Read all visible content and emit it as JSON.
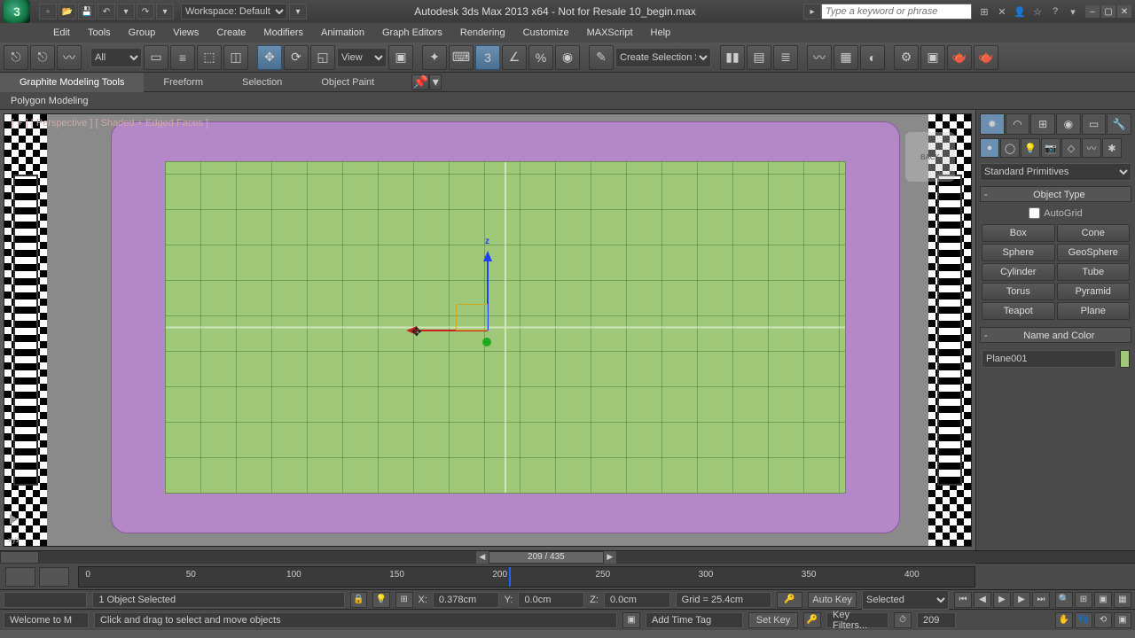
{
  "titlebar": {
    "workspace_label": "Workspace: Default",
    "title": "Autodesk 3ds Max  2013 x64 - Not for Resale    10_begin.max",
    "search_placeholder": "Type a keyword or phrase"
  },
  "menu": [
    "Edit",
    "Tools",
    "Group",
    "Views",
    "Create",
    "Modifiers",
    "Animation",
    "Graph Editors",
    "Rendering",
    "Customize",
    "MAXScript",
    "Help"
  ],
  "toolbar": {
    "filter": "All",
    "ref_coord": "View",
    "selection_set": "Create Selection Set"
  },
  "ribbon": {
    "tabs": [
      "Graphite Modeling Tools",
      "Freeform",
      "Selection",
      "Object Paint"
    ],
    "active_tab": 0,
    "sub": "Polygon Modeling"
  },
  "viewport": {
    "label": "[ + ] [ Perspective ] [ Shaded + Edged Faces ]",
    "gizmo_z": "z"
  },
  "cmd": {
    "dropdown": "Standard Primitives",
    "object_type_hdr": "Object Type",
    "autogrid": "AutoGrid",
    "buttons": [
      "Box",
      "Cone",
      "Sphere",
      "GeoSphere",
      "Cylinder",
      "Tube",
      "Torus",
      "Pyramid",
      "Teapot",
      "Plane"
    ],
    "name_hdr": "Name and Color",
    "object_name": "Plane001"
  },
  "timeslider": {
    "frame_display": "209 / 435"
  },
  "trackbar": {
    "ticks": [
      0,
      50,
      100,
      150,
      200,
      250,
      300,
      350,
      400
    ]
  },
  "status": {
    "welcome": "Welcome to M",
    "selection": "1 Object Selected",
    "prompt": "Click and drag to select and move objects",
    "x_label": "X:",
    "x_val": "0.378cm",
    "y_label": "Y:",
    "y_val": "0.0cm",
    "z_label": "Z:",
    "z_val": "0.0cm",
    "grid": "Grid = 25.4cm",
    "add_tag": "Add Time Tag",
    "auto_key": "Auto Key",
    "set_key": "Set Key",
    "selected": "Selected",
    "key_filters": "Key Filters...",
    "frame": "209"
  }
}
